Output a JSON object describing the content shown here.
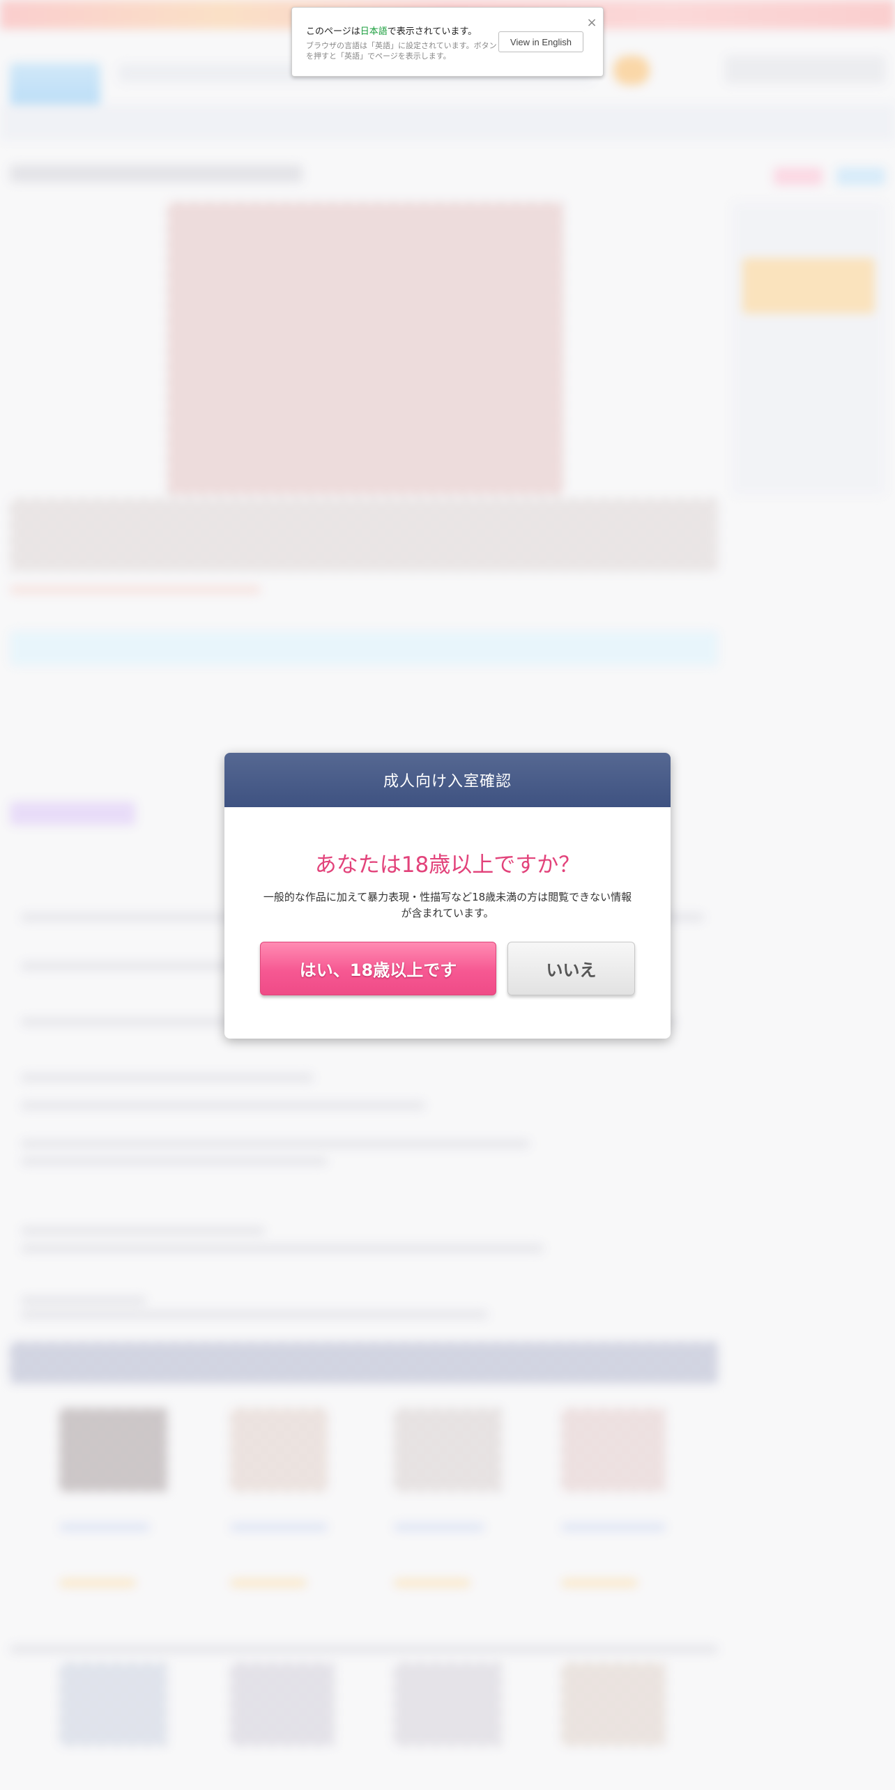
{
  "translate_popup": {
    "line1_prefix": "このページは",
    "line1_language": "日本語",
    "line1_suffix": "で表示されています。",
    "line2": "ブラウザの言語は「英語」に設定されています。ボタンを押すと「英語」でページを表示します。",
    "button_label": "View in English",
    "close_icon": "×"
  },
  "age_gate": {
    "header_title": "成人向け入室確認",
    "question": "あなたは18歳以上ですか？",
    "description": "一般的な作品に加えて暴力表現・性描写など18歳未満の方は閲覧できない情報が含まれています。",
    "yes_label": "はい、18歳以上です",
    "no_label": "いいえ"
  },
  "colors": {
    "modal_header": "#46598a",
    "question_text": "#e2427a",
    "yes_button": "#f65892",
    "translate_highlight": "#1b9e3e"
  }
}
